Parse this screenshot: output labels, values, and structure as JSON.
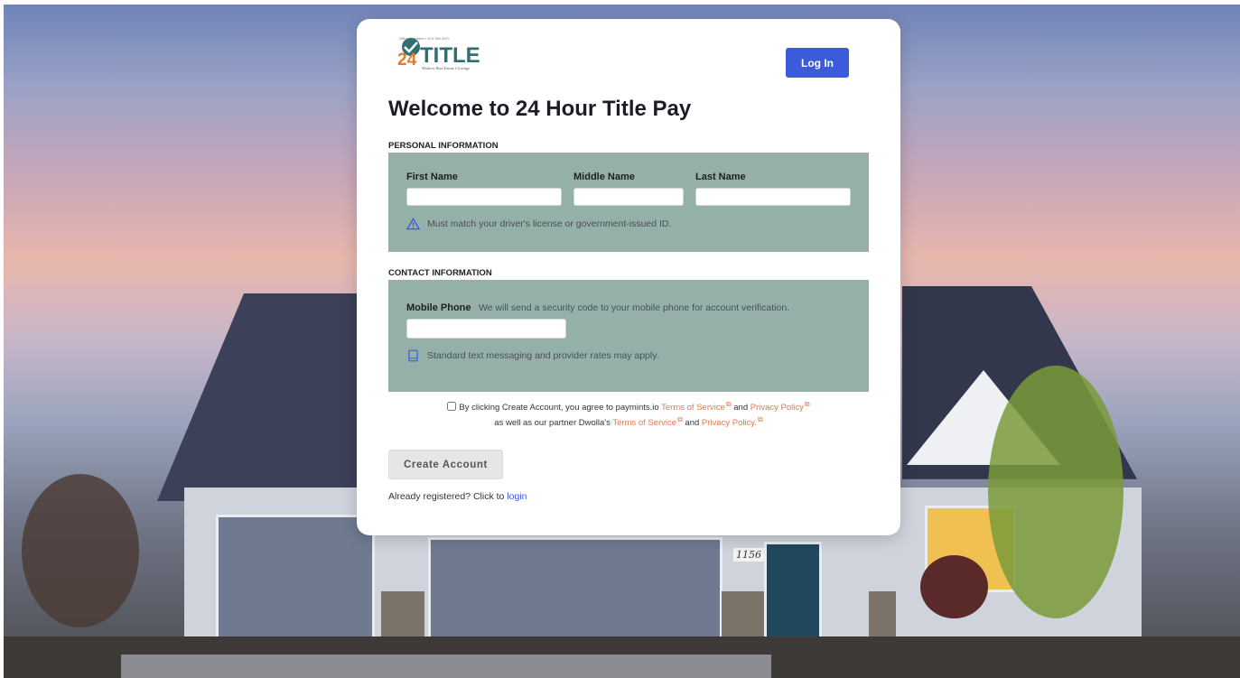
{
  "brand": {
    "logo_number": "24",
    "logo_word": "TITLE",
    "logo_caption": "Official Member / 214 765 3237",
    "logo_tagline": "Modern Real Estate Closings"
  },
  "header": {
    "login_button": "Log In",
    "title": "Welcome to 24 Hour Title Pay"
  },
  "personal": {
    "section_label": "PERSONAL INFORMATION",
    "first_name_label": "First Name",
    "middle_name_label": "Middle Name",
    "last_name_label": "Last Name",
    "first_name_value": "",
    "middle_name_value": "",
    "last_name_value": "",
    "note": "Must match your driver's license or government-issued ID."
  },
  "contact": {
    "section_label": "CONTACT INFORMATION",
    "phone_label": "Mobile Phone",
    "phone_hint": "We will send a security code to your mobile phone for account verification.",
    "phone_value": "",
    "note": "Standard text messaging and provider rates may apply."
  },
  "terms": {
    "text1": "By clicking Create Account, you agree to paymints.io",
    "tos1": "Terms of Service",
    "and1": "and",
    "privacy1": "Privacy Policy",
    "text2": "as well as our partner Dwolla's",
    "tos2": "Terms of Service",
    "and2": "and",
    "privacy2": "Privacy Policy.",
    "checked": false
  },
  "actions": {
    "create_button": "Create Account",
    "already_text": "Already registered? Click to",
    "login_link": "login"
  },
  "background": {
    "house_number": "1156"
  },
  "colors": {
    "accent": "#3b5bdb",
    "panel": "#95b0a9",
    "link": "#e07a4f",
    "logo_orange": "#e8772e",
    "logo_teal": "#2f6f73"
  },
  "icons": {
    "id_note_icon": "warning-triangle-icon",
    "phone_note_icon": "mobile-phone-icon",
    "external_link_icon": "external-link-icon"
  }
}
